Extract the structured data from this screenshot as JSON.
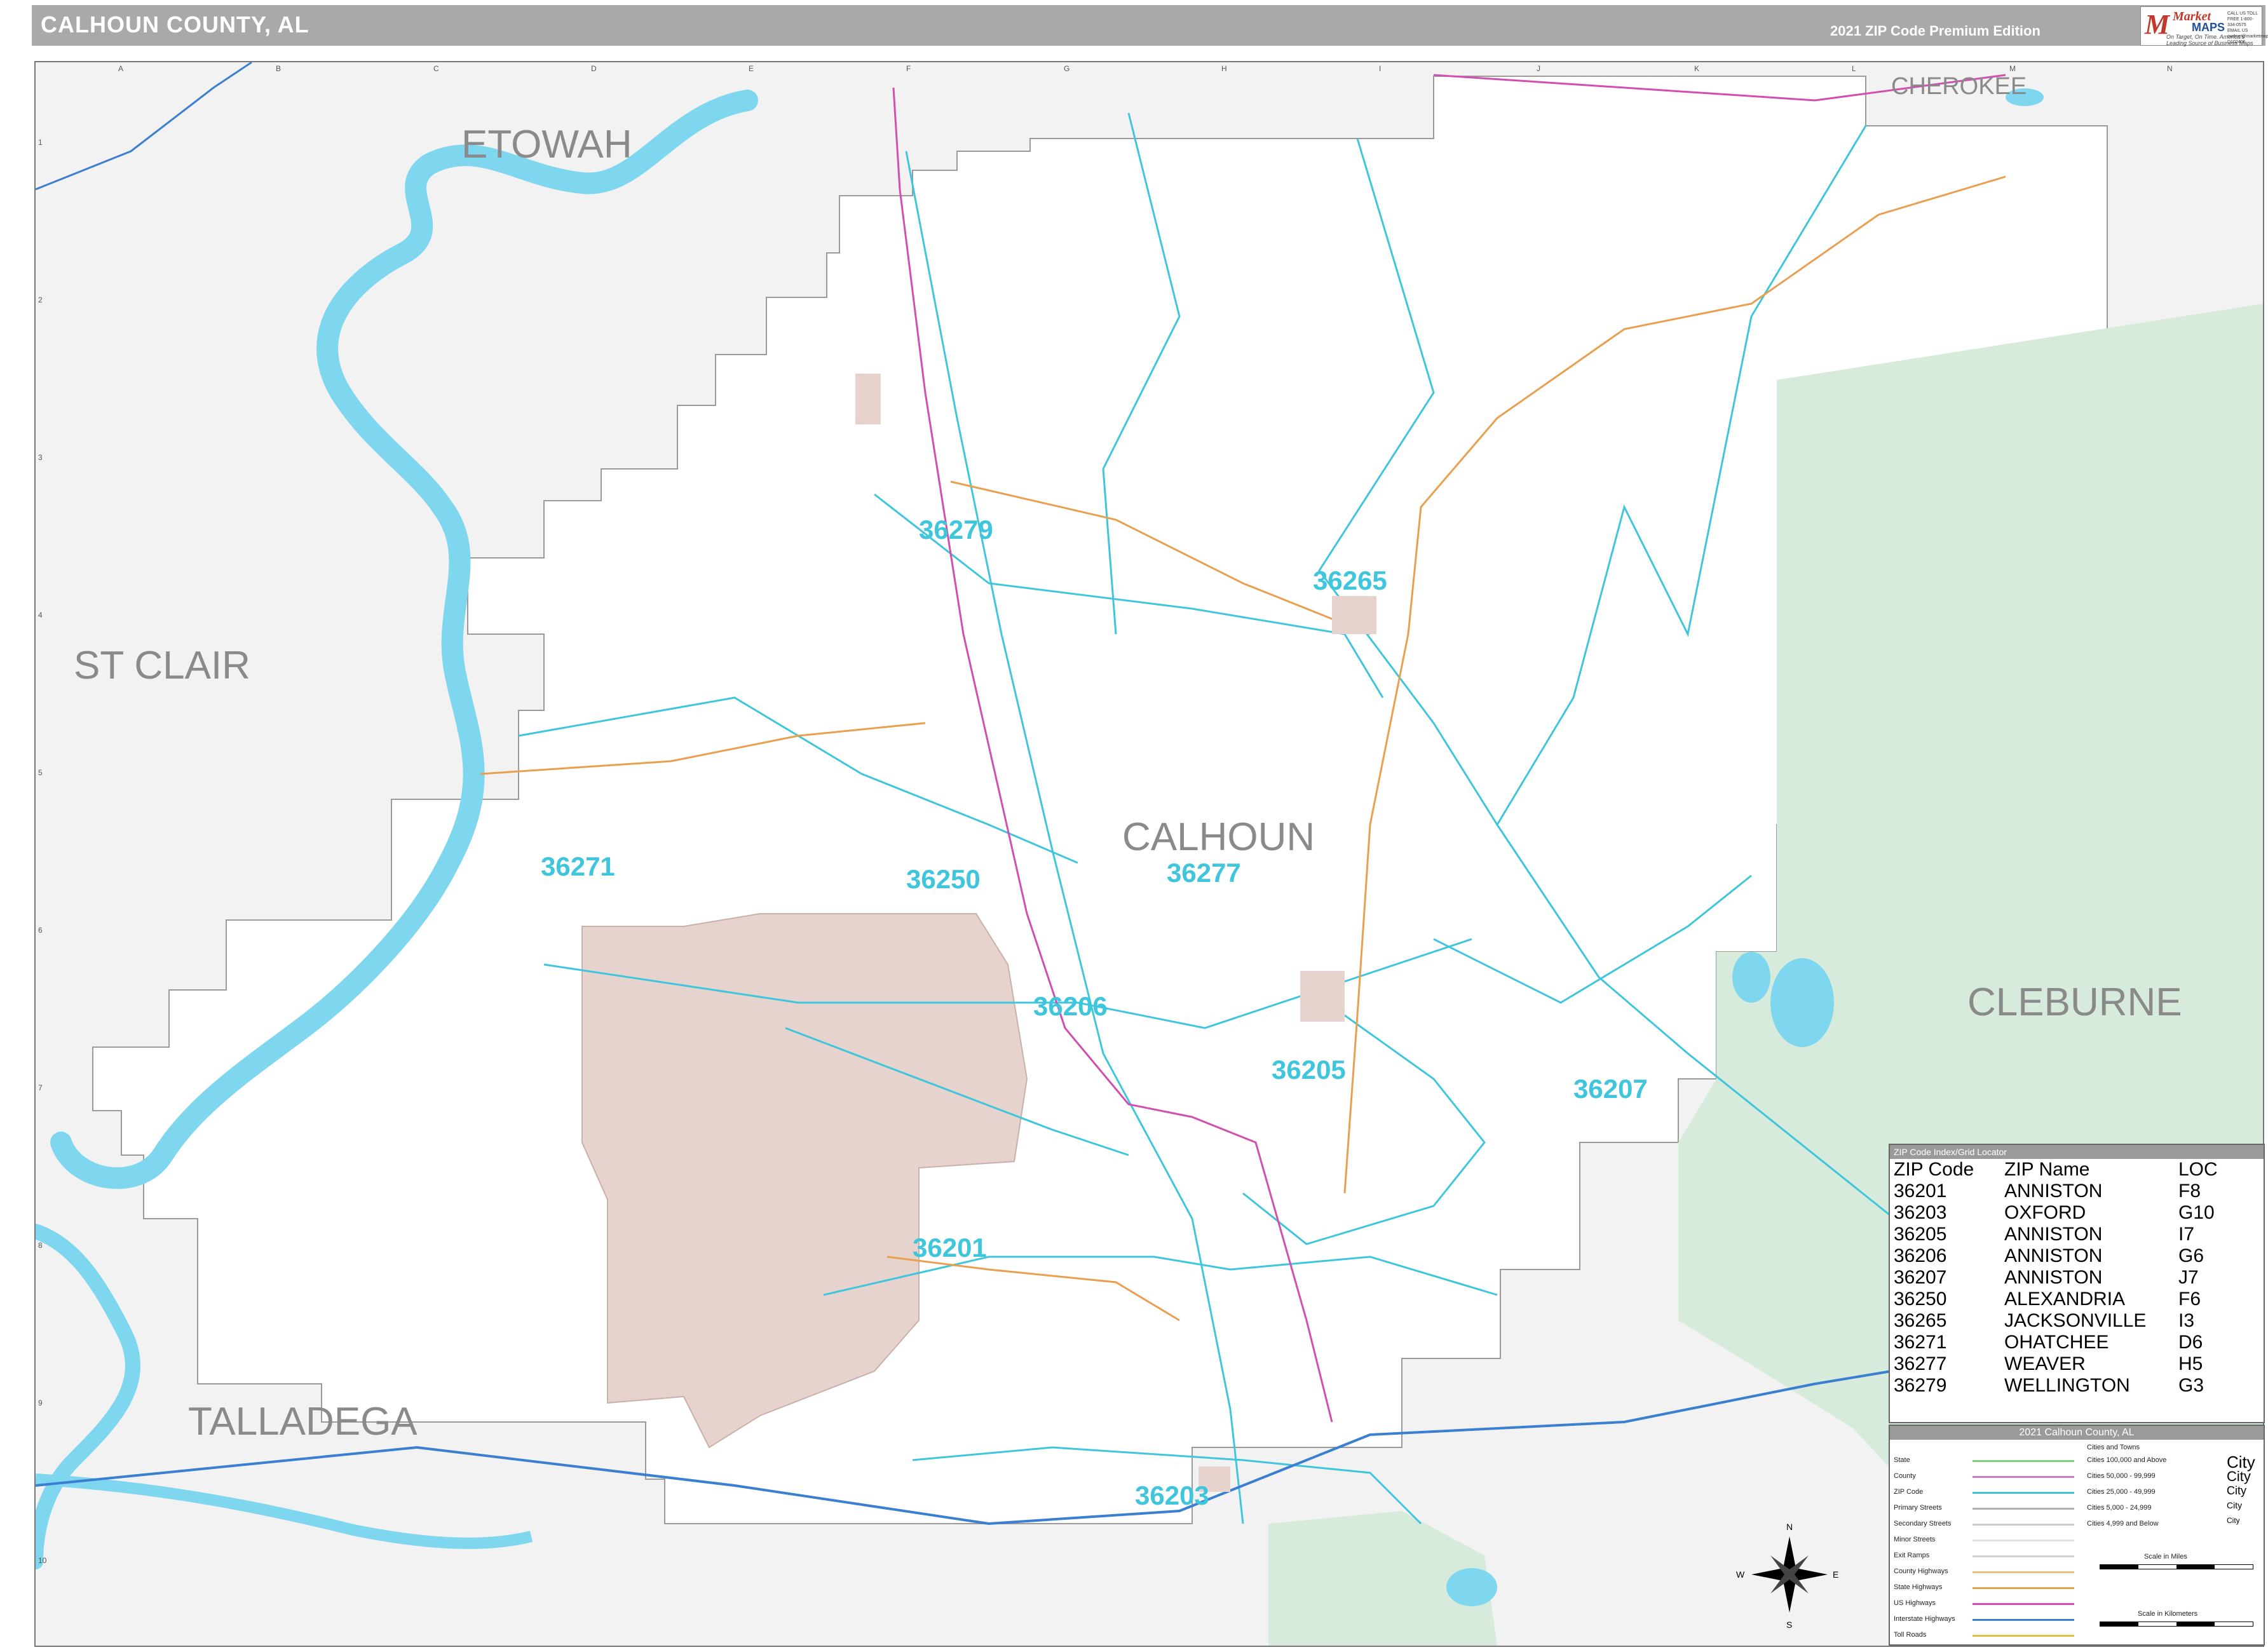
{
  "header": {
    "title": "CALHOUN COUNTY, AL",
    "edition": "2021 ZIP Code Premium Edition"
  },
  "logo": {
    "market": "Market",
    "maps": "MAPS",
    "tagline": "On Target, On Time. America's Leading Source of Business Maps",
    "contact": "CALL US TOLL FREE 1-800-334-0575 EMAIL US custom@marketmaps.com D102406"
  },
  "grid": {
    "letters": [
      "A",
      "B",
      "C",
      "D",
      "E",
      "F",
      "G",
      "H",
      "I",
      "J",
      "K",
      "L",
      "M",
      "N"
    ],
    "numbers": [
      "1",
      "2",
      "3",
      "4",
      "5",
      "6",
      "7",
      "8",
      "9",
      "10"
    ]
  },
  "counties": [
    {
      "name": "ETOWAH"
    },
    {
      "name": "CHEROKEE"
    },
    {
      "name": "ST CLAIR"
    },
    {
      "name": "CALHOUN"
    },
    {
      "name": "CLEBURNE"
    },
    {
      "name": "TALLADEGA"
    }
  ],
  "zip_labels": [
    {
      "zip": "36279"
    },
    {
      "zip": "36265"
    },
    {
      "zip": "36271"
    },
    {
      "zip": "36250"
    },
    {
      "zip": "36277"
    },
    {
      "zip": "36206"
    },
    {
      "zip": "36205"
    },
    {
      "zip": "36207"
    },
    {
      "zip": "36201"
    },
    {
      "zip": "36203"
    }
  ],
  "zip_index": {
    "title": "ZIP Code Index/Grid Locator",
    "headers": [
      "ZIP Code",
      "ZIP Name",
      "LOC"
    ],
    "rows": [
      [
        "36201",
        "ANNISTON",
        "F8"
      ],
      [
        "36203",
        "OXFORD",
        "G10"
      ],
      [
        "36205",
        "ANNISTON",
        "I7"
      ],
      [
        "36206",
        "ANNISTON",
        "G6"
      ],
      [
        "36207",
        "ANNISTON",
        "J7"
      ],
      [
        "36250",
        "ALEXANDRIA",
        "F6"
      ],
      [
        "36265",
        "JACKSONVILLE",
        "I3"
      ],
      [
        "36271",
        "OHATCHEE",
        "D6"
      ],
      [
        "36277",
        "WEAVER",
        "H5"
      ],
      [
        "36279",
        "WELLINGTON",
        "G3"
      ]
    ]
  },
  "legend": {
    "title": "2021 Calhoun County, AL",
    "cities_title": "Cities and Towns",
    "items": [
      {
        "label": "State",
        "color": "#7fd07f"
      },
      {
        "label": "County",
        "color": "#c77cc7"
      },
      {
        "label": "ZIP Code",
        "color": "#3fc6dc"
      },
      {
        "label": "Primary Streets",
        "color": "#b0b0b0"
      },
      {
        "label": "Secondary Streets",
        "color": "#cccccc"
      },
      {
        "label": "Minor Streets",
        "color": "#e0e0e0"
      },
      {
        "label": "Exit Ramps",
        "color": "#d0d0d0"
      },
      {
        "label": "County Highways",
        "color": "#f0c080"
      },
      {
        "label": "State Highways",
        "color": "#e8a050"
      },
      {
        "label": "US Highways",
        "color": "#d04fb0"
      },
      {
        "label": "Interstate Highways",
        "color": "#3a7fd0"
      },
      {
        "label": "Toll Roads",
        "color": "#e0c040"
      }
    ],
    "city_sizes": [
      {
        "label": "Cities 100,000 and Above",
        "sample": "City"
      },
      {
        "label": "Cities 50,000 - 99,999",
        "sample": "City"
      },
      {
        "label": "Cities 25,000 - 49,999",
        "sample": "City"
      },
      {
        "label": "Cities 5,000 - 24,999",
        "sample": "City"
      },
      {
        "label": "Cities 4,999 and Below",
        "sample": "City"
      }
    ],
    "scale_miles": "Scale in Miles",
    "scale_km": "Scale in Kilometers"
  },
  "compass": {
    "n": "N",
    "s": "S",
    "e": "E",
    "w": "W"
  },
  "colors": {
    "water": "#7fd6ef",
    "neighbor_county": "#f0f0f0",
    "forest": "#d7ebdc",
    "military": "#e6d3cd",
    "zip_boundary": "#3fc6dc",
    "county_boundary": "#a0a0a0"
  }
}
